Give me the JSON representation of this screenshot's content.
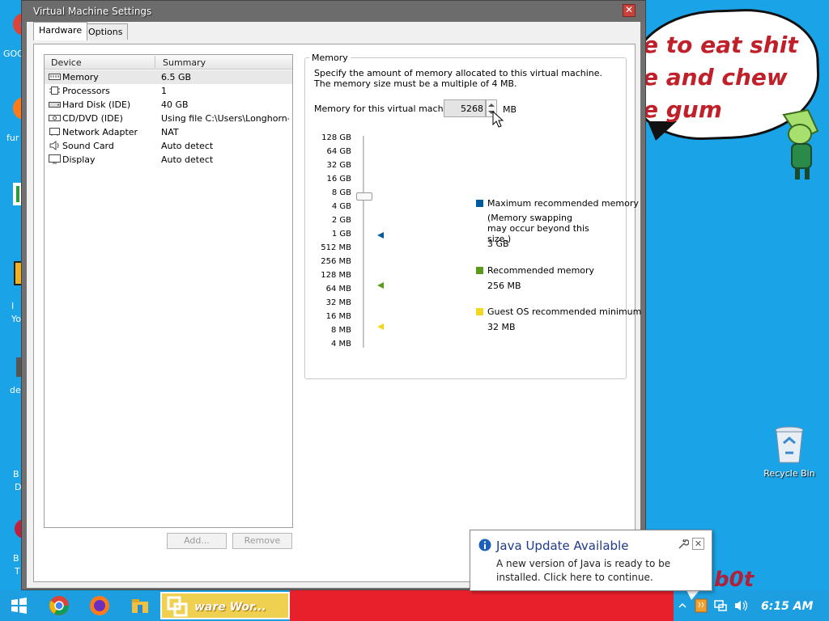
{
  "window": {
    "title": "Virtual Machine Settings",
    "close_glyph": "✕"
  },
  "tabs": [
    {
      "label": "Hardware",
      "active": true
    },
    {
      "label": "Options",
      "active": false
    }
  ],
  "device_list": {
    "columns": [
      "Device",
      "Summary"
    ],
    "rows": [
      {
        "device": "Memory",
        "summary": "6.5 GB",
        "icon": "memory-icon",
        "selected": true
      },
      {
        "device": "Processors",
        "summary": "1",
        "icon": "processor-icon"
      },
      {
        "device": "Hard Disk (IDE)",
        "summary": "40 GB",
        "icon": "hard-disk-icon"
      },
      {
        "device": "CD/DVD (IDE)",
        "summary": "Using file C:\\Users\\Longhorn-...",
        "icon": "cd-dvd-icon"
      },
      {
        "device": "Network Adapter",
        "summary": "NAT",
        "icon": "network-adapter-icon"
      },
      {
        "device": "Sound Card",
        "summary": "Auto detect",
        "icon": "speaker-icon"
      },
      {
        "device": "Display",
        "summary": "Auto detect",
        "icon": "monitor-icon"
      }
    ],
    "add_label": "Add...",
    "remove_label": "Remove"
  },
  "memory": {
    "group_title": "Memory",
    "description": "Specify the amount of memory allocated to this virtual machine. The memory size must be a multiple of 4 MB.",
    "field_label": "Memory for this virtual machine:",
    "value": "5268",
    "unit": "MB",
    "scale": [
      "128 GB",
      "64 GB",
      "32 GB",
      "16 GB",
      "8 GB",
      "4 GB",
      "2 GB",
      "1 GB",
      "512 MB",
      "256 MB",
      "128 MB",
      "64 MB",
      "32 MB",
      "16 MB",
      "8 MB",
      "4 MB"
    ],
    "legend": {
      "max": {
        "label": "Maximum recommended memory",
        "note": "(Memory swapping may occur beyond this size.)",
        "value": "3 GB",
        "color": "#005aa0"
      },
      "rec": {
        "label": "Recommended memory",
        "value": "256 MB",
        "color": "#5a9a1a"
      },
      "min": {
        "label": "Guest OS recommended minimum",
        "value": "32 MB",
        "color": "#f0d820"
      }
    }
  },
  "desktop": {
    "bubble_lines": [
      "e to eat shit",
      "e and chew",
      "e gum"
    ],
    "corner_text": "b0t",
    "recycle_bin_label": "Recycle Bin",
    "left_labels": [
      "GOO",
      "fur",
      "I",
      "Yo",
      "de",
      "B",
      "D",
      "B",
      "T"
    ]
  },
  "taskbar": {
    "active_app_label": "ware Wor...",
    "clock": "6:15 AM"
  },
  "java_popup": {
    "title": "Java Update Available",
    "body": "A new version of Java is ready to be installed. Click here to continue.",
    "close_glyph": "✕"
  }
}
